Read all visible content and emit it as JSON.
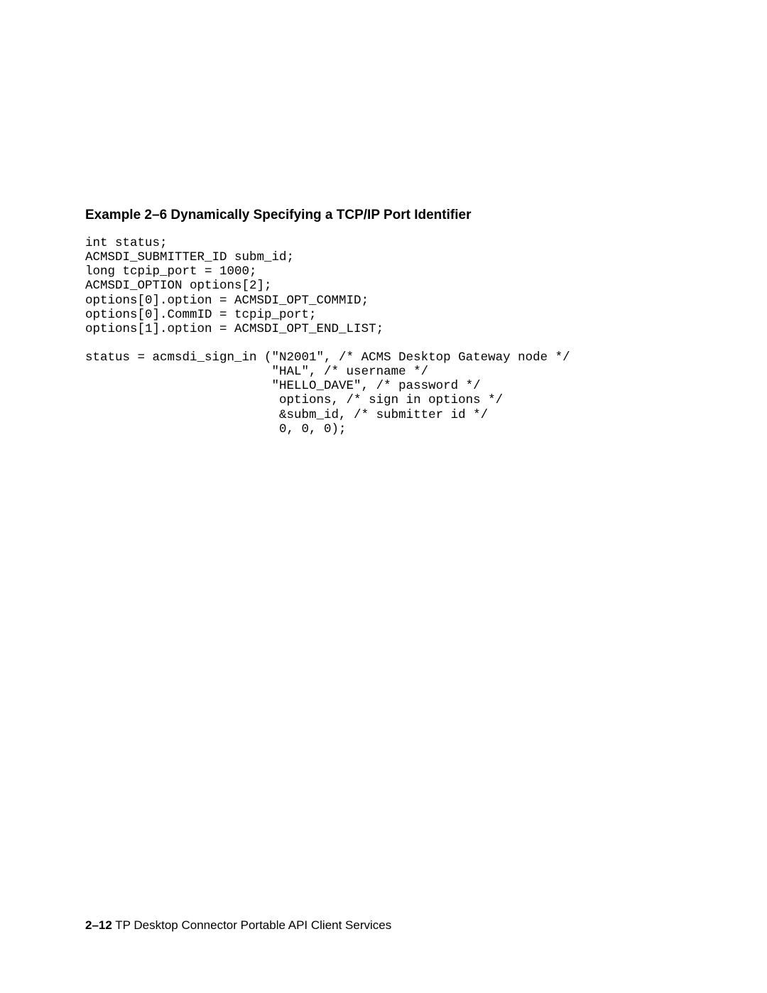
{
  "example": {
    "title": "Example 2–6   Dynamically Specifying a TCP/IP Port Identifier",
    "code": "int status;\nACMSDI_SUBMITTER_ID subm_id;\nlong tcpip_port = 1000;\nACMSDI_OPTION options[2];\noptions[0].option = ACMSDI_OPT_COMMID;\noptions[0].CommID = tcpip_port;\noptions[1].option = ACMSDI_OPT_END_LIST;\n\nstatus = acmsdi_sign_in (\"N2001\", /* ACMS Desktop Gateway node */\n                         \"HAL\", /* username */\n                         \"HELLO_DAVE\", /* password */\n                          options, /* sign in options */\n                          &subm_id, /* submitter id */\n                          0, 0, 0);"
  },
  "footer": {
    "page_number": "2–12",
    "section_title": "TP Desktop Connector Portable API Client Services"
  }
}
